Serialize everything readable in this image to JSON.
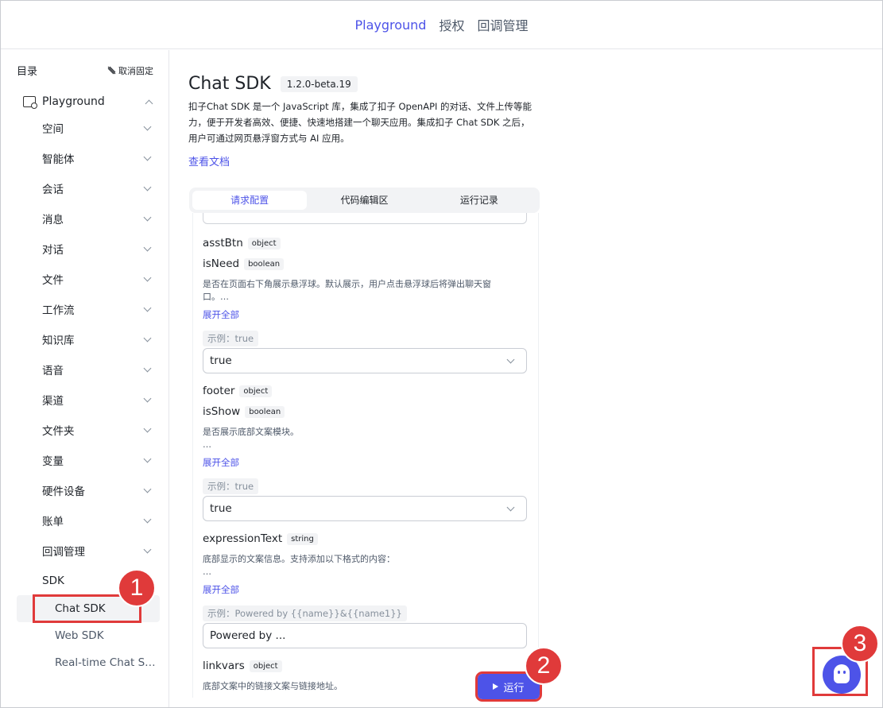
{
  "topnav": {
    "items": [
      "Playground",
      "授权",
      "回调管理"
    ]
  },
  "sidebar": {
    "title": "目录",
    "unpin": "取消固定",
    "group": "Playground",
    "items": [
      "空间",
      "智能体",
      "会话",
      "消息",
      "对话",
      "文件",
      "工作流",
      "知识库",
      "语音",
      "渠道",
      "文件夹",
      "变量",
      "硬件设备",
      "账单",
      "回调管理",
      "SDK"
    ],
    "sdk_items": [
      "Chat SDK",
      "Web SDK",
      "Real-time Chat S…"
    ]
  },
  "main": {
    "title": "Chat SDK",
    "version": "1.2.0-beta.19",
    "desc_lines": [
      "扣子Chat SDK 是一个 JavaScript 库，集成了扣子 OpenAPI 的对话、文件上传等能",
      "力，便于开发者高效、便捷、快速地搭建一个聊天应用。集成扣子 Chat SDK 之后，",
      "用户可通过网页悬浮窗方式与 AI 应用。"
    ],
    "doc_link": "查看文档",
    "tabs": [
      "请求配置",
      "代码编辑区",
      "运行记录"
    ],
    "fields": {
      "asstBtn": {
        "name": "asstBtn",
        "type": "object"
      },
      "isNeed": {
        "name": "isNeed",
        "type": "boolean",
        "desc1": "是否在页面右下角展示悬浮球。默认展示，用户点击悬浮球后将弹出聊天窗",
        "desc2": "口。…",
        "expand": "展开全部",
        "example": "示例：true",
        "value": "true"
      },
      "footer": {
        "name": "footer",
        "type": "object"
      },
      "isShow": {
        "name": "isShow",
        "type": "boolean",
        "desc1": "是否展示底部文案模块。",
        "desc2": "…",
        "expand": "展开全部",
        "example": "示例：true",
        "value": "true"
      },
      "expressionText": {
        "name": "expressionText",
        "type": "string",
        "desc1": "底部显示的文案信息。支持添加以下格式的内容：",
        "desc2": "…",
        "expand": "展开全部",
        "example": "示例：Powered by {{name}}&{{name1}}",
        "value": "Powered by ..."
      },
      "linkvars": {
        "name": "linkvars",
        "type": "object",
        "desc1": "底部文案中的链接文案与链接地址。"
      }
    },
    "run_label": "运行"
  },
  "annotations": [
    "1",
    "2",
    "3"
  ],
  "colors": {
    "accent": "#4d53e8",
    "annotation": "#e03a3a"
  }
}
